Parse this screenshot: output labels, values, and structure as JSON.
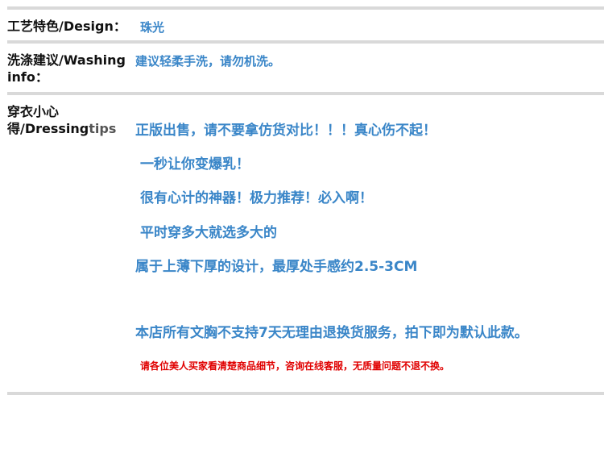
{
  "rows": {
    "design": {
      "label": "工艺特色/Design：",
      "value": "珠光"
    },
    "washing": {
      "label_line1": "洗涤建议/Washing",
      "label_line2": "info：",
      "value": "建议轻柔手洗，请勿机洗。"
    },
    "dressing": {
      "label_line1": "穿衣小心",
      "label_line2_a": "得/Dressing",
      "label_line2_b": "tips",
      "tips": [
        "正版出售，请不要拿仿货对比！！！真心伤不起！",
        "一秒让你变爆乳！",
        "很有心计的神器！极力推荐！必入啊！",
        "平时穿多大就选多大的",
        "属于上薄下厚的设计，最厚处手感约2.5-3CM",
        "本店所有文胸不支持7天无理由退换货服务，拍下即为默认此款。"
      ],
      "notice": "请各位美人买家看清楚商品细节，咨询在线客服，无质量问题不退不换。"
    }
  },
  "colors": {
    "accent_blue": "#3a86c8",
    "notice_red": "#e00000",
    "rule_gray": "#d9d9d9"
  }
}
